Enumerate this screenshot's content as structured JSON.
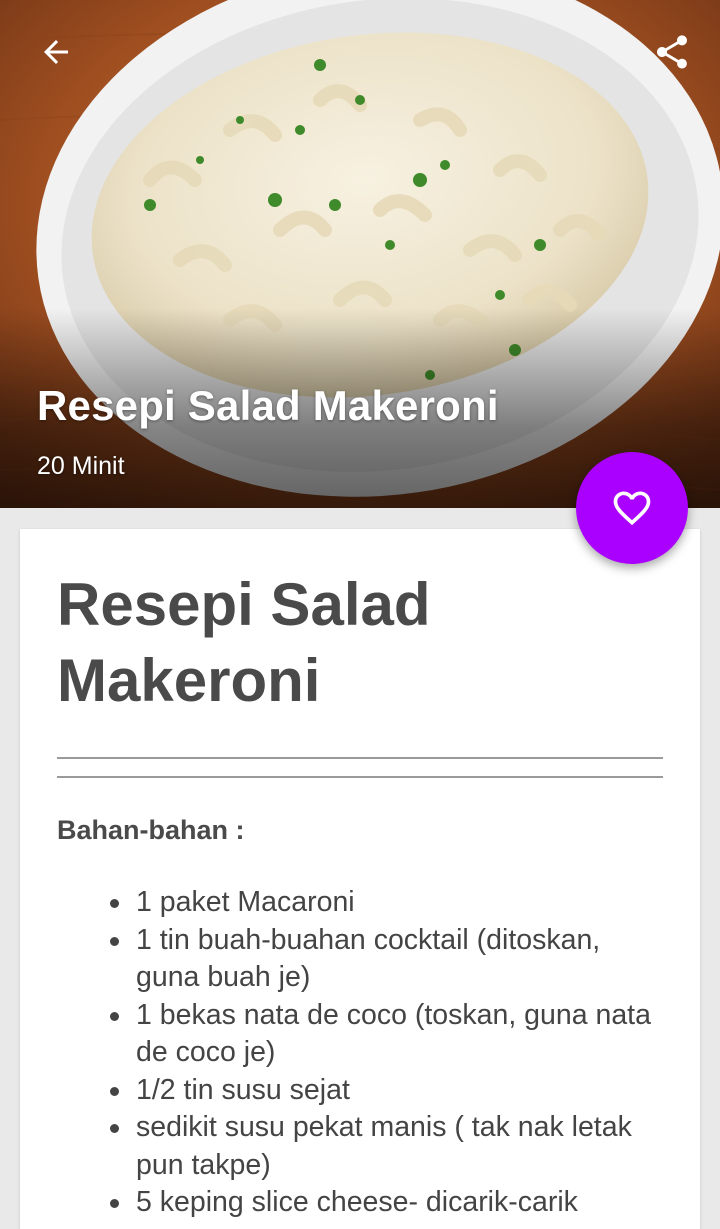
{
  "hero": {
    "title": "Resepi Salad Makeroni",
    "subtitle": "20 Minit"
  },
  "toolbar": {
    "back_icon": "arrow-left-icon",
    "share_icon": "share-icon"
  },
  "fab": {
    "icon": "heart-outline-icon",
    "color": "#aa00ff"
  },
  "card": {
    "title": "Resepi Salad Makeroni",
    "section_heading": "Bahan-bahan :",
    "ingredients": [
      "1 paket Macaroni",
      "1 tin buah-buahan cocktail (ditoskan, guna buah je)",
      "1 bekas nata de coco (toskan, guna nata de coco je)",
      "1/2 tin susu sejat",
      "sedikit susu pekat manis ( tak nak letak pun takpe)",
      "5 keping slice cheese- dicarik-carik"
    ]
  },
  "colors": {
    "accent": "#aa00ff",
    "text": "#4a4a4a",
    "background": "#e9e9e9"
  }
}
